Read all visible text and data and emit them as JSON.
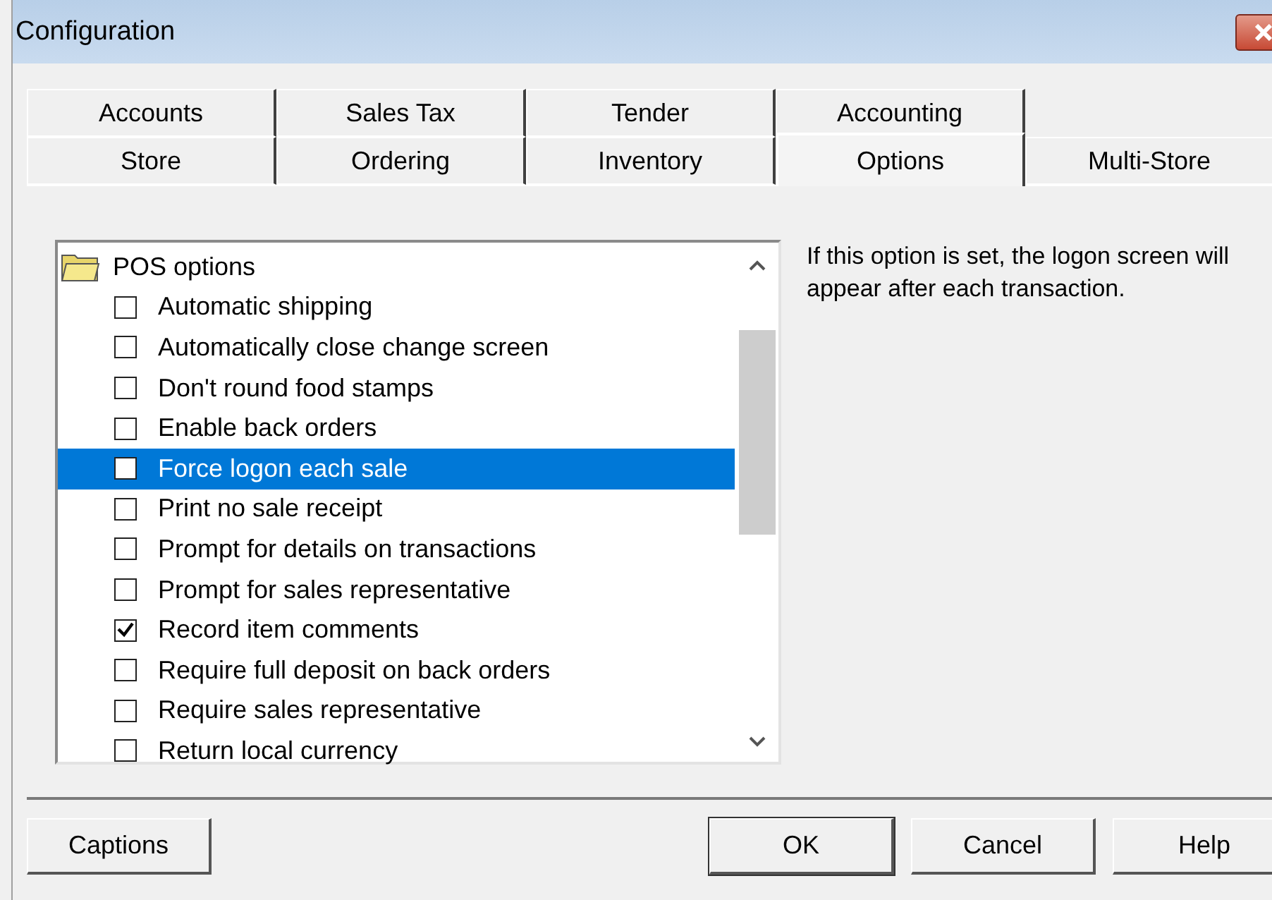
{
  "window": {
    "title": "Configuration"
  },
  "tab_rows": [
    {
      "tabs": [
        {
          "label": "Accounts",
          "selected": false
        },
        {
          "label": "Sales Tax",
          "selected": false
        },
        {
          "label": "Tender",
          "selected": false
        },
        {
          "label": "Accounting",
          "selected": false
        }
      ]
    },
    {
      "tabs": [
        {
          "label": "Store",
          "selected": false
        },
        {
          "label": "Ordering",
          "selected": false
        },
        {
          "label": "Inventory",
          "selected": false
        },
        {
          "label": "Options",
          "selected": true
        },
        {
          "label": "Multi-Store",
          "selected": false
        }
      ]
    }
  ],
  "options_tree": {
    "label": "POS options",
    "children": [
      {
        "label": "Automatic shipping",
        "checked": false,
        "selected": false
      },
      {
        "label": "Automatically close change screen",
        "checked": false,
        "selected": false
      },
      {
        "label": "Don't round food stamps",
        "checked": false,
        "selected": false
      },
      {
        "label": "Enable back orders",
        "checked": false,
        "selected": false
      },
      {
        "label": "Force logon each sale",
        "checked": false,
        "selected": true
      },
      {
        "label": "Print no sale receipt",
        "checked": false,
        "selected": false
      },
      {
        "label": "Prompt for details on transactions",
        "checked": false,
        "selected": false
      },
      {
        "label": "Prompt for sales representative",
        "checked": false,
        "selected": false
      },
      {
        "label": "Record item comments",
        "checked": true,
        "selected": false
      },
      {
        "label": "Require full deposit on back orders",
        "checked": false,
        "selected": false
      },
      {
        "label": "Require sales representative",
        "checked": false,
        "selected": false
      },
      {
        "label": "Return local currency",
        "checked": false,
        "selected": false
      }
    ]
  },
  "description": "If this option is set, the logon screen will appear after each transaction.",
  "buttons": [
    {
      "label": "Captions",
      "kind": "left"
    },
    {
      "label": "OK",
      "kind": "default"
    },
    {
      "label": "Cancel",
      "kind": "right"
    },
    {
      "label": "Help",
      "kind": "right"
    }
  ]
}
